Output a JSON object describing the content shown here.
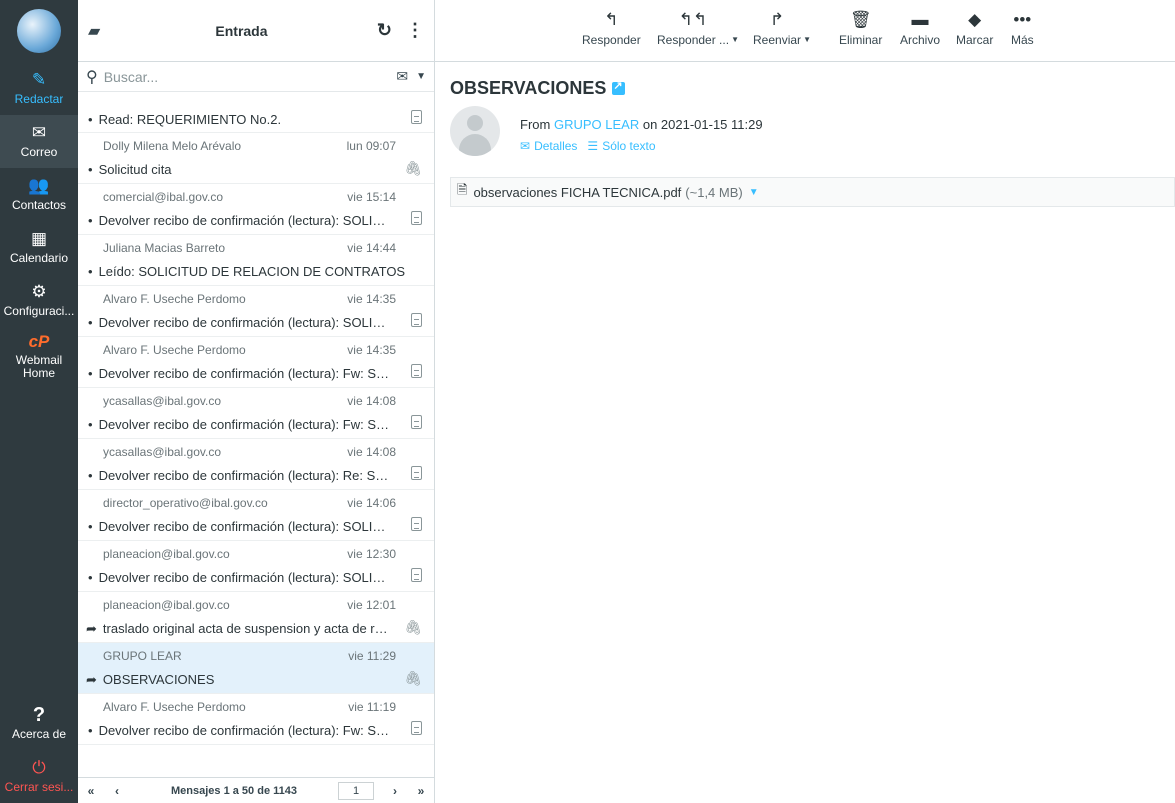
{
  "nav": {
    "items": [
      {
        "label": "Redactar",
        "icon": "compose-icon",
        "glyph": "✎"
      },
      {
        "label": "Correo",
        "icon": "mail-icon",
        "glyph": "✉"
      },
      {
        "label": "Contactos",
        "icon": "contacts-icon",
        "glyph": "👥"
      },
      {
        "label": "Calendario",
        "icon": "calendar-icon",
        "glyph": "▦"
      },
      {
        "label": "Configuraci...",
        "icon": "gear-icon",
        "glyph": "⚙"
      },
      {
        "label": "Webmail Home",
        "icon": "cpanel-icon",
        "glyph": "cP"
      }
    ],
    "about": {
      "label": "Acerca de",
      "glyph": "?"
    },
    "logout": {
      "label": "Cerrar sesi...",
      "glyph": "⏻"
    }
  },
  "list": {
    "folder_title": "Entrada",
    "search_placeholder": "Buscar...",
    "messages": [
      {
        "from": "",
        "date": "",
        "subject": "Read: REQUERIMIENTO No.2.",
        "prefix": "•",
        "attach": "doc"
      },
      {
        "from": "Dolly Milena Melo Arévalo",
        "date": "lun 09:07",
        "subject": "Solicitud cita",
        "prefix": "•",
        "attach": "clip"
      },
      {
        "from": "comercial@ibal.gov.co",
        "date": "vie 15:14",
        "subject": "Devolver recibo de confirmación (lectura): SOLICITUD DE RELACION",
        "prefix": "•",
        "attach": "doc"
      },
      {
        "from": "Juliana Macias Barreto",
        "date": "vie 14:44",
        "subject": "Leído: SOLICITUD DE RELACION DE CONTRATOS",
        "prefix": "•",
        "attach": ""
      },
      {
        "from": "Alvaro F. Useche Perdomo",
        "date": "vie 14:35",
        "subject": "Devolver recibo de confirmación (lectura): SOLICITUD DE",
        "prefix": "•",
        "attach": "doc"
      },
      {
        "from": "Alvaro F. Useche Perdomo",
        "date": "vie 14:35",
        "subject": "Devolver recibo de confirmación (lectura): Fw: SOLICITUD",
        "prefix": "•",
        "attach": "doc"
      },
      {
        "from": "ycasallas@ibal.gov.co",
        "date": "vie 14:08",
        "subject": "Devolver recibo de confirmación (lectura): Fw: SOLICITUD",
        "prefix": "•",
        "attach": "doc"
      },
      {
        "from": "ycasallas@ibal.gov.co",
        "date": "vie 14:08",
        "subject": "Devolver recibo de confirmación (lectura): Re: SOLICITUD",
        "prefix": "•",
        "attach": "doc"
      },
      {
        "from": "director_operativo@ibal.gov.co",
        "date": "vie 14:06",
        "subject": "Devolver recibo de confirmación (lectura): SOLICITUD DE",
        "prefix": "•",
        "attach": "doc"
      },
      {
        "from": "planeacion@ibal.gov.co",
        "date": "vie 12:30",
        "subject": "Devolver recibo de confirmación (lectura): SOLICITUD DE",
        "prefix": "•",
        "attach": "doc"
      },
      {
        "from": "planeacion@ibal.gov.co",
        "date": "vie 12:01",
        "subject": "traslado original acta de suspension y acta de reinicio",
        "prefix": "➦",
        "attach": "clip"
      },
      {
        "from": "GRUPO LEAR",
        "date": "vie 11:29",
        "subject": "OBSERVACIONES",
        "prefix": "➦",
        "attach": "clip"
      },
      {
        "from": "Alvaro F. Useche Perdomo",
        "date": "vie 11:19",
        "subject": "Devolver recibo de confirmación (lectura): Fw: SOLICITUD",
        "prefix": "•",
        "attach": "doc"
      }
    ],
    "pager_text": "Mensajes 1 a 50 de 1143",
    "page_number": "1"
  },
  "toolbar": {
    "reply": "Responder",
    "reply_all": "Responder ...",
    "forward": "Reenviar",
    "delete": "Eliminar",
    "archive": "Archivo",
    "mark": "Marcar",
    "more": "Más"
  },
  "preview": {
    "subject": "OBSERVACIONES",
    "from_prefix": "From",
    "from_name": "GRUPO LEAR",
    "on_text": "on 2021-01-15 11:29",
    "details": "Detalles",
    "plain_text": "Sólo texto",
    "attachment_name": "observaciones FICHA TECNICA.pdf",
    "attachment_size": "(~1,4 MB)"
  },
  "colors": {
    "nav_bg": "#2f3a3f",
    "accent": "#37beff",
    "logout": "#ff5552",
    "selected_row": "#e3f1fb"
  }
}
